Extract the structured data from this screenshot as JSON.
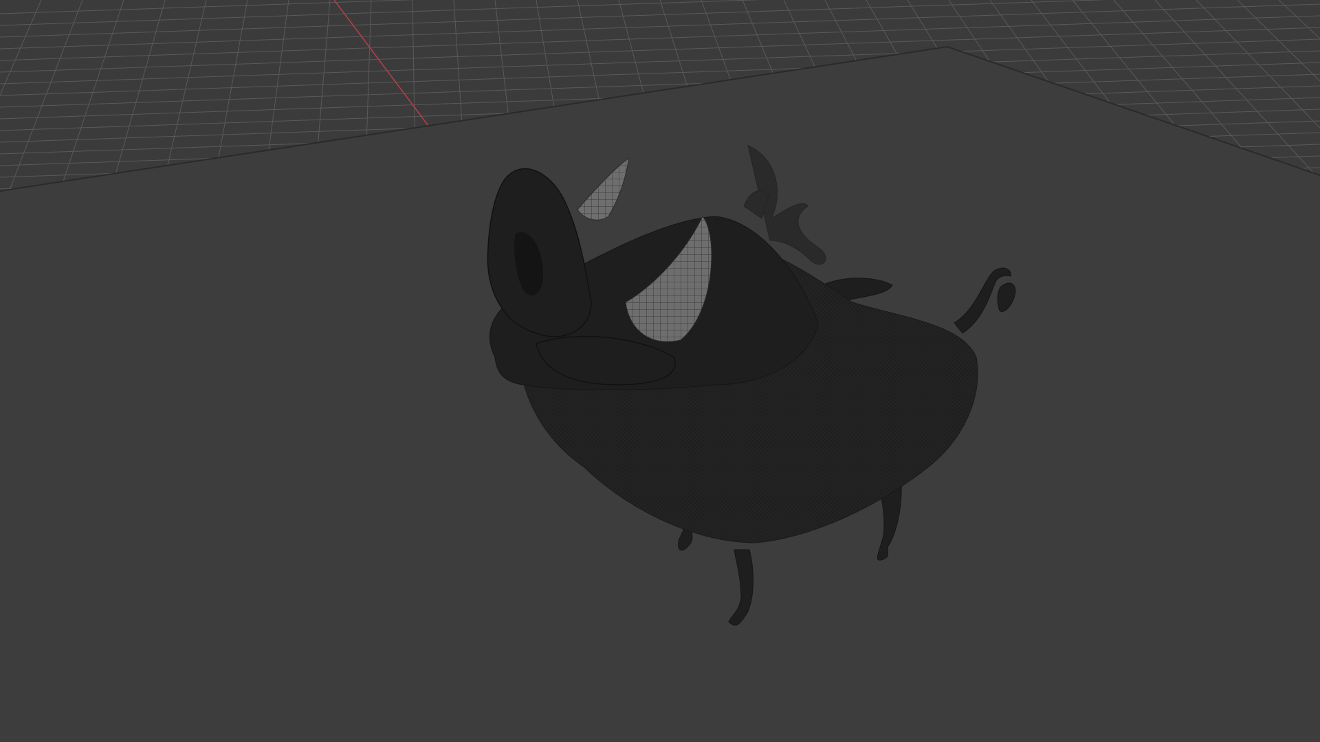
{
  "viewport": {
    "name": "3d-viewport",
    "background_color": "#3d3d3d",
    "grid_line_color": "#5a5a5a",
    "grid_major_color": "#6a6a6a",
    "ground_plane_color": "#3d3d3d",
    "plane_edge_color": "#2a2a2a",
    "x_axis_color": "#b0404a",
    "model": {
      "name": "warthog-character-mesh",
      "display_mode": "wireframe-on-shaded",
      "body_color": "#1e1e1e",
      "highlight_color": "#2b2b2b",
      "tusk_color": "#6b6b6b",
      "mane_color": "#2a2a2a"
    }
  }
}
